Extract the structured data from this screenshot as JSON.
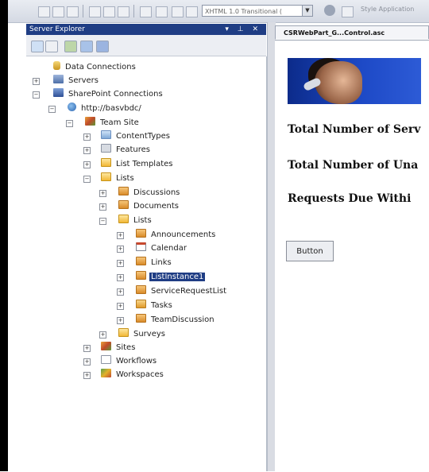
{
  "toolbar": {
    "doctype_select": "XHTML 1.0 Transitional ( ",
    "style_label": "Style Application"
  },
  "server_explorer": {
    "title": "Server Explorer",
    "title_controls": "▾ ⊥ ✕",
    "tree": [
      {
        "label": "Data Connections",
        "icon": "database-icon"
      },
      {
        "label": "Servers",
        "icon": "server-icon"
      },
      {
        "label": "SharePoint Connections",
        "icon": "sharepoint-icon"
      },
      {
        "label": "http://basvbdc/",
        "icon": "globe-icon"
      },
      {
        "label": "Team Site",
        "icon": "site-icon"
      },
      {
        "label": "ContentTypes",
        "icon": "content-type-icon"
      },
      {
        "label": "Features",
        "icon": "features-icon"
      },
      {
        "label": "List Templates",
        "icon": "folder-icon"
      },
      {
        "label": "Lists",
        "icon": "folder-icon"
      },
      {
        "label": "Discussions",
        "icon": "list-icon"
      },
      {
        "label": "Documents",
        "icon": "list-icon"
      },
      {
        "label": "Lists",
        "icon": "folder-icon"
      },
      {
        "label": "Announcements",
        "icon": "list-icon"
      },
      {
        "label": "Calendar",
        "icon": "calendar-icon"
      },
      {
        "label": "Links",
        "icon": "list-icon"
      },
      {
        "label": "ListInstance1",
        "icon": "list-icon"
      },
      {
        "label": "ServiceRequestList",
        "icon": "list-icon"
      },
      {
        "label": "Tasks",
        "icon": "tasks-icon"
      },
      {
        "label": "TeamDiscussion",
        "icon": "list-icon"
      },
      {
        "label": "Surveys",
        "icon": "folder-icon"
      },
      {
        "label": "Sites",
        "icon": "site-icon"
      },
      {
        "label": "Workflows",
        "icon": "workflow-icon"
      },
      {
        "label": "Workspaces",
        "icon": "workspace-icon"
      }
    ],
    "selected": "ListInstance1"
  },
  "editor": {
    "tab_label": "CSRWebPart_G...Control.asc",
    "heading1": "Total Number of Serv",
    "heading2": "Total Number of Una",
    "heading3": "Requests Due Withi",
    "button_label": "Button"
  },
  "colors": {
    "title_bar": "#1f3d84",
    "selection": "#1f3d84"
  }
}
